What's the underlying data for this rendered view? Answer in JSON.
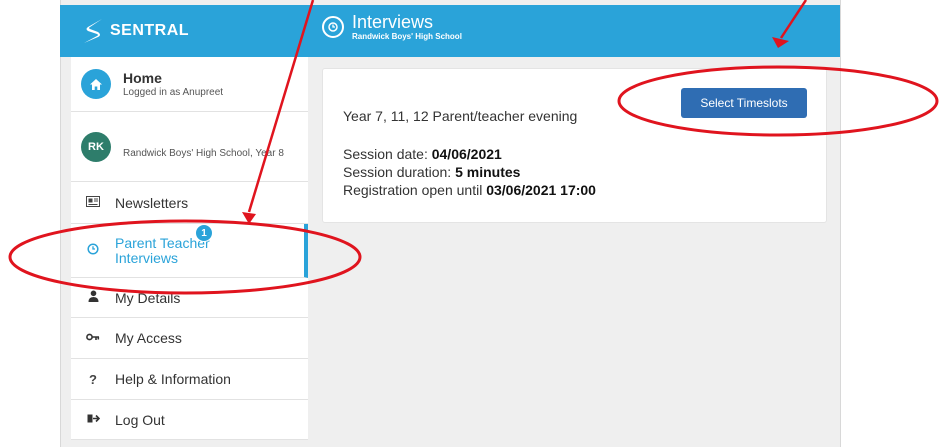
{
  "brand": {
    "name": "SENTRAL"
  },
  "header": {
    "title": "Interviews",
    "subtitle": "Randwick Boys' High School"
  },
  "sidebar": {
    "home": {
      "label": "Home",
      "sub": "Logged in as Anupreet"
    },
    "student": {
      "initials": "RK",
      "sub": "Randwick Boys' High School, Year 8"
    },
    "items": [
      {
        "label": "Newsletters",
        "icon": "newspaper-icon"
      },
      {
        "label": "Parent Teacher Interviews",
        "icon": "clock-icon",
        "badge": "1",
        "active": true
      },
      {
        "label": "My Details",
        "icon": "user-icon"
      },
      {
        "label": "My Access",
        "icon": "key-icon"
      },
      {
        "label": "Help & Information",
        "icon": "question-icon"
      },
      {
        "label": "Log Out",
        "icon": "logout-icon"
      }
    ]
  },
  "event": {
    "title": "Year 7, 11, 12 Parent/teacher evening",
    "button_label": "Select Timeslots",
    "date_label": "Session date:",
    "date_value": "04/06/2021",
    "duration_label": "Session duration:",
    "duration_value": "5 minutes",
    "reg_label": "Registration open until",
    "reg_value": "03/06/2021 17:00"
  },
  "colors": {
    "accent": "#2aa3d9",
    "button": "#2f6db3",
    "annotation": "#e0141e"
  }
}
